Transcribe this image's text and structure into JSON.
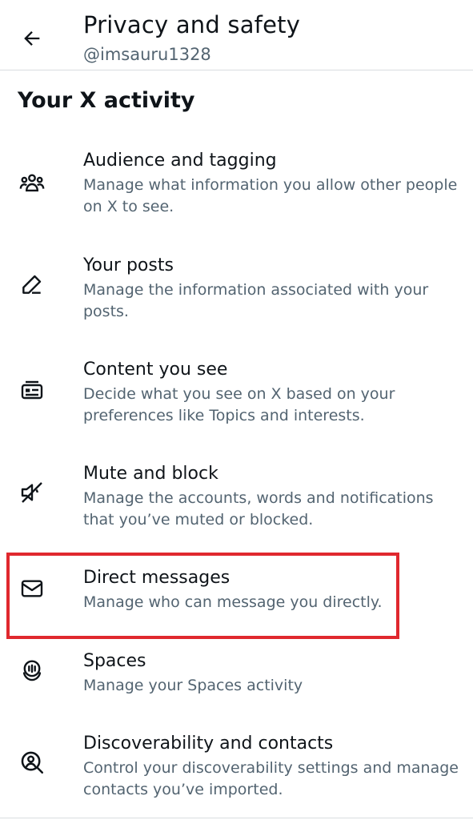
{
  "header": {
    "title": "Privacy and safety",
    "handle": "@imsauru1328"
  },
  "section": {
    "title": "Your X activity"
  },
  "items": [
    {
      "title": "Audience and tagging",
      "desc": "Manage what information you allow other people on X to see.",
      "icon": "people-icon"
    },
    {
      "title": "Your posts",
      "desc": "Manage the information associated with your posts.",
      "icon": "pencil-icon"
    },
    {
      "title": "Content you see",
      "desc": "Decide what you see on X based on your preferences like Topics and interests.",
      "icon": "content-card-icon"
    },
    {
      "title": "Mute and block",
      "desc": "Manage the accounts, words and notifications that you’ve muted or blocked.",
      "icon": "muted-speaker-icon"
    },
    {
      "title": "Direct messages",
      "desc": "Manage who can message you directly.",
      "icon": "envelope-icon"
    },
    {
      "title": "Spaces",
      "desc": "Manage your Spaces activity",
      "icon": "spaces-mic-icon"
    },
    {
      "title": "Discoverability and contacts",
      "desc": "Control your discoverability settings and manage contacts you’ve imported.",
      "icon": "discover-person-icon"
    }
  ],
  "colors": {
    "text_primary": "#0f1419",
    "text_secondary": "#536471",
    "highlight_border": "#e0282e",
    "divider": "#d9dde0"
  }
}
